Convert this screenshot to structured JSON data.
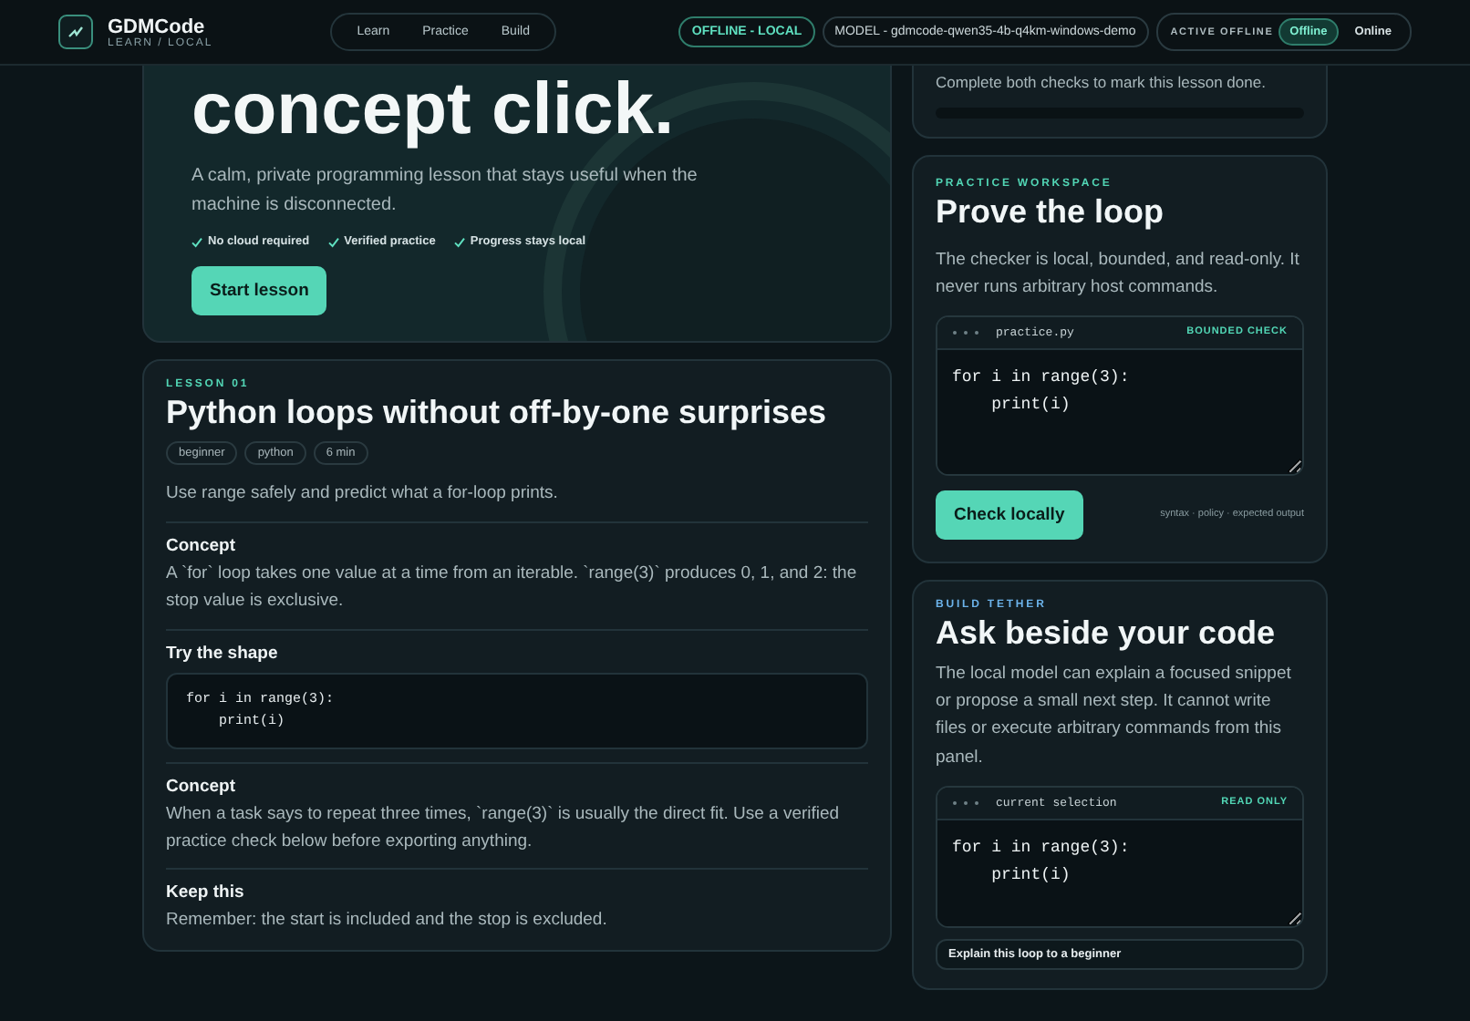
{
  "brand": {
    "name": "GDMCode",
    "subtitle": "LEARN / LOCAL"
  },
  "nav": [
    {
      "label": "Learn"
    },
    {
      "label": "Practice"
    },
    {
      "label": "Build"
    }
  ],
  "status_badge": "OFFLINE - LOCAL",
  "model_badge": "MODEL - gdmcode-qwen35-4b-q4km-windows-demo",
  "mode_toggle": {
    "label": "ACTIVE OFFLINE",
    "options": [
      {
        "label": "Offline",
        "selected": true
      },
      {
        "label": "Online",
        "selected": false
      }
    ]
  },
  "hero": {
    "title": "concept click.",
    "text": "A calm, private programming lesson that stays useful when the machine is disconnected.",
    "checks": [
      "No cloud required",
      "Verified practice",
      "Progress stays local"
    ],
    "button": "Start lesson"
  },
  "lesson": {
    "eyebrow": "LESSON 01",
    "title": "Python loops without off-by-one surprises",
    "tags": [
      "beginner",
      "python",
      "6 min"
    ],
    "summary": "Use range safely and predict what a for-loop prints.",
    "sections": [
      {
        "kind": "text",
        "heading": "Concept",
        "body": "A `for` loop takes one value at a time from an iterable. `range(3)` produces 0, 1, and 2: the stop value is exclusive."
      },
      {
        "kind": "code",
        "heading": "Try the shape",
        "body": "for i in range(3):\n    print(i)"
      },
      {
        "kind": "text",
        "heading": "Concept",
        "body": "When a task says to repeat three times, `range(3)` is usually the direct fit. Use a verified practice check below before exporting anything."
      },
      {
        "kind": "text",
        "heading": "Keep this",
        "body": "Remember: the start is included and the stop is excluded."
      }
    ]
  },
  "progress": {
    "text": "Complete both checks to mark this lesson done."
  },
  "practice": {
    "eyebrow": "PRACTICE WORKSPACE",
    "title": "Prove the loop",
    "text": "The checker is local, bounded, and read-only. It never runs arbitrary host commands.",
    "editor": {
      "file": "practice.py",
      "badge": "BOUNDED CHECK",
      "code": "for i in range(3):\n    print(i)"
    },
    "button": "Check locally",
    "hint": "syntax · policy · expected output"
  },
  "build": {
    "eyebrow": "BUILD TETHER",
    "title": "Ask beside your code",
    "text": "The local model can explain a focused snippet or propose a small next step. It cannot write files or execute arbitrary commands from this panel.",
    "editor": {
      "file": "current selection",
      "badge": "READ ONLY",
      "code": "for i in range(3):\n    print(i)"
    },
    "prompt": "Explain this loop to a beginner"
  }
}
